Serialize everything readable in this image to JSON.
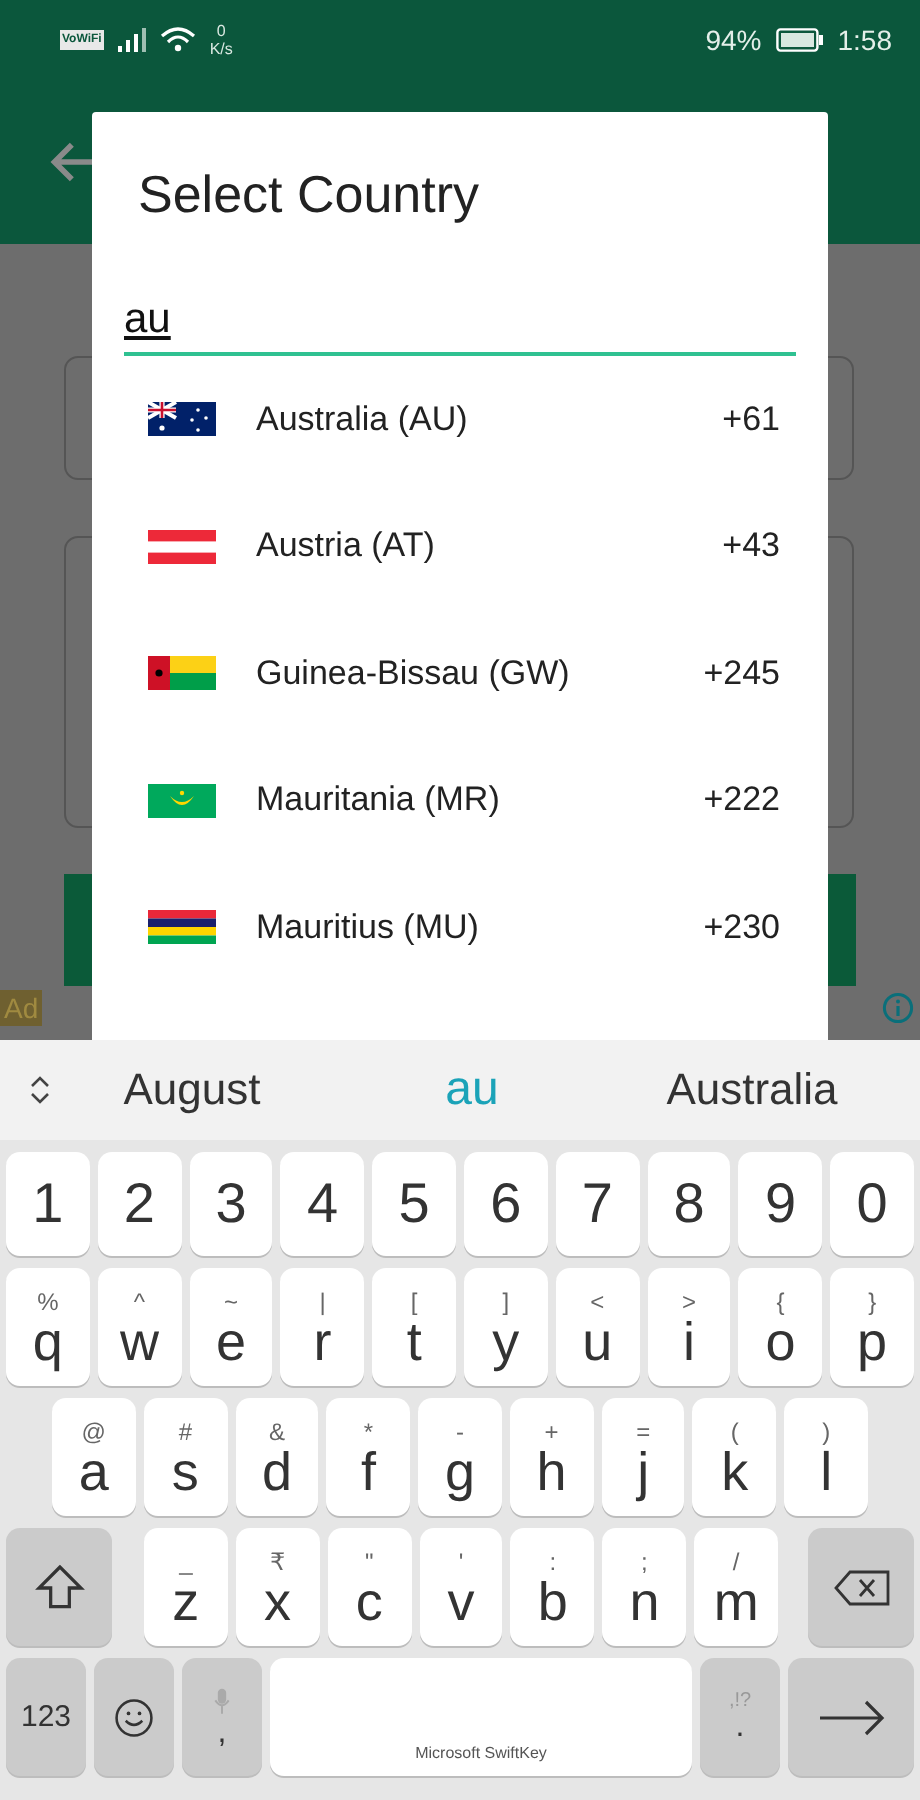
{
  "status_bar": {
    "vowifi": "VoWiFi",
    "speed_value": "0",
    "speed_unit": "K/s",
    "battery": "94%",
    "time": "1:58"
  },
  "background": {
    "ad_label": "Ad"
  },
  "dialog": {
    "title": "Select Country",
    "search": {
      "value": "au"
    },
    "countries": [
      {
        "name": "Australia (AU)",
        "code": "+61",
        "kind": "au"
      },
      {
        "name": "Austria (AT)",
        "code": "+43",
        "kind": "at"
      },
      {
        "name": "Guinea-Bissau (GW)",
        "code": "+245",
        "kind": "gw"
      },
      {
        "name": "Mauritania (MR)",
        "code": "+222",
        "kind": "mr"
      },
      {
        "name": "Mauritius (MU)",
        "code": "+230",
        "kind": "mu"
      }
    ]
  },
  "keyboard": {
    "suggestions": [
      {
        "text": "August",
        "selected": false
      },
      {
        "text": "au",
        "selected": true
      },
      {
        "text": "Australia",
        "selected": false
      }
    ],
    "rows": [
      [
        {
          "kind": "char",
          "label": "1"
        },
        {
          "kind": "char",
          "label": "2"
        },
        {
          "kind": "char",
          "label": "3"
        },
        {
          "kind": "char",
          "label": "4"
        },
        {
          "kind": "char",
          "label": "5"
        },
        {
          "kind": "char",
          "label": "6"
        },
        {
          "kind": "char",
          "label": "7"
        },
        {
          "kind": "char",
          "label": "8"
        },
        {
          "kind": "char",
          "label": "9"
        },
        {
          "kind": "char",
          "label": "0"
        }
      ],
      [
        {
          "kind": "char",
          "label": "q",
          "hint": "%"
        },
        {
          "kind": "char",
          "label": "w",
          "hint": "^"
        },
        {
          "kind": "char",
          "label": "e",
          "hint": "~"
        },
        {
          "kind": "char",
          "label": "r",
          "hint": "|"
        },
        {
          "kind": "char",
          "label": "t",
          "hint": "["
        },
        {
          "kind": "char",
          "label": "y",
          "hint": "]"
        },
        {
          "kind": "char",
          "label": "u",
          "hint": "<"
        },
        {
          "kind": "char",
          "label": "i",
          "hint": ">"
        },
        {
          "kind": "char",
          "label": "o",
          "hint": "{"
        },
        {
          "kind": "char",
          "label": "p",
          "hint": "}"
        }
      ],
      [
        {
          "kind": "char",
          "label": "a",
          "hint": "@"
        },
        {
          "kind": "char",
          "label": "s",
          "hint": "#"
        },
        {
          "kind": "char",
          "label": "d",
          "hint": "&"
        },
        {
          "kind": "char",
          "label": "f",
          "hint": "*"
        },
        {
          "kind": "char",
          "label": "g",
          "hint": "-"
        },
        {
          "kind": "char",
          "label": "h",
          "hint": "+"
        },
        {
          "kind": "char",
          "label": "j",
          "hint": "="
        },
        {
          "kind": "char",
          "label": "k",
          "hint": "("
        },
        {
          "kind": "char",
          "label": "l",
          "hint": ")"
        }
      ],
      [
        {
          "kind": "shift"
        },
        {
          "kind": "char",
          "label": "z",
          "hint": "_"
        },
        {
          "kind": "char",
          "label": "x",
          "hint": "₹"
        },
        {
          "kind": "char",
          "label": "c",
          "hint": "\""
        },
        {
          "kind": "char",
          "label": "v",
          "hint": "'"
        },
        {
          "kind": "char",
          "label": "b",
          "hint": ":"
        },
        {
          "kind": "char",
          "label": "n",
          "hint": ";"
        },
        {
          "kind": "char",
          "label": "m",
          "hint": "/"
        },
        {
          "kind": "backspace"
        }
      ],
      [
        {
          "kind": "numbers",
          "label": "123"
        },
        {
          "kind": "emoji"
        },
        {
          "kind": "comma",
          "label": ","
        },
        {
          "kind": "space",
          "label": "Microsoft SwiftKey"
        },
        {
          "kind": "period",
          "label": ".",
          "hint": ",!?"
        },
        {
          "kind": "enter"
        }
      ]
    ]
  }
}
